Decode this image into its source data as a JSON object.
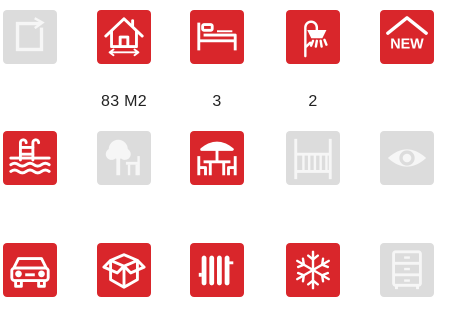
{
  "labels": {
    "area": "83 M2",
    "bedrooms": "3",
    "bathrooms": "2"
  },
  "new_badge_text": "NEW",
  "colors": {
    "active": "#d9262b",
    "inactive": "#dcdcdc",
    "icon": "#ffffff"
  },
  "amenities": [
    {
      "icon": "floor-plan-icon",
      "active": false
    },
    {
      "icon": "house-area-icon",
      "active": true
    },
    {
      "icon": "bed-icon",
      "active": true
    },
    {
      "icon": "shower-icon",
      "active": true
    },
    {
      "icon": "new-house-icon",
      "active": true
    },
    {
      "icon": "pool-icon",
      "active": true
    },
    {
      "icon": "garden-icon",
      "active": false
    },
    {
      "icon": "terrace-icon",
      "active": true
    },
    {
      "icon": "balcony-icon",
      "active": false
    },
    {
      "icon": "view-icon",
      "active": false
    },
    {
      "icon": "car-icon",
      "active": true
    },
    {
      "icon": "storage-box-icon",
      "active": true
    },
    {
      "icon": "heating-icon",
      "active": true
    },
    {
      "icon": "air-conditioning-icon",
      "active": true
    },
    {
      "icon": "furniture-icon",
      "active": false
    }
  ]
}
